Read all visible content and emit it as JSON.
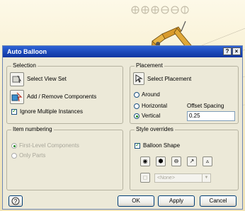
{
  "dialog": {
    "title": "Auto Balloon",
    "title_buttons": {
      "help": "?",
      "close": "×"
    }
  },
  "selection": {
    "legend": "Selection",
    "select_view_set": "Select View Set",
    "add_remove_components": "Add / Remove Components",
    "ignore_multiple_instances": "Ignore Multiple Instances",
    "ignore_multiple_checked": true
  },
  "placement": {
    "legend": "Placement",
    "select_placement": "Select Placement",
    "options": [
      "Around",
      "Horizontal",
      "Vertical"
    ],
    "selected": "Vertical",
    "offset_spacing_label": "Offset Spacing",
    "offset_spacing_value": "0.25"
  },
  "item_numbering": {
    "legend": "Item numbering",
    "options": [
      "First-Level Components",
      "Only Parts"
    ],
    "selected": "First-Level Components"
  },
  "style_overrides": {
    "legend": "Style overrides",
    "balloon_shape_label": "Balloon Shape",
    "balloon_shape_checked": true,
    "style_select_value": "<None>"
  },
  "footer": {
    "ok": "OK",
    "apply": "Apply",
    "cancel": "Cancel"
  },
  "colors": {
    "titlebar": "#1b48b8",
    "background": "#ece9d8",
    "model": "#d89a2c"
  }
}
